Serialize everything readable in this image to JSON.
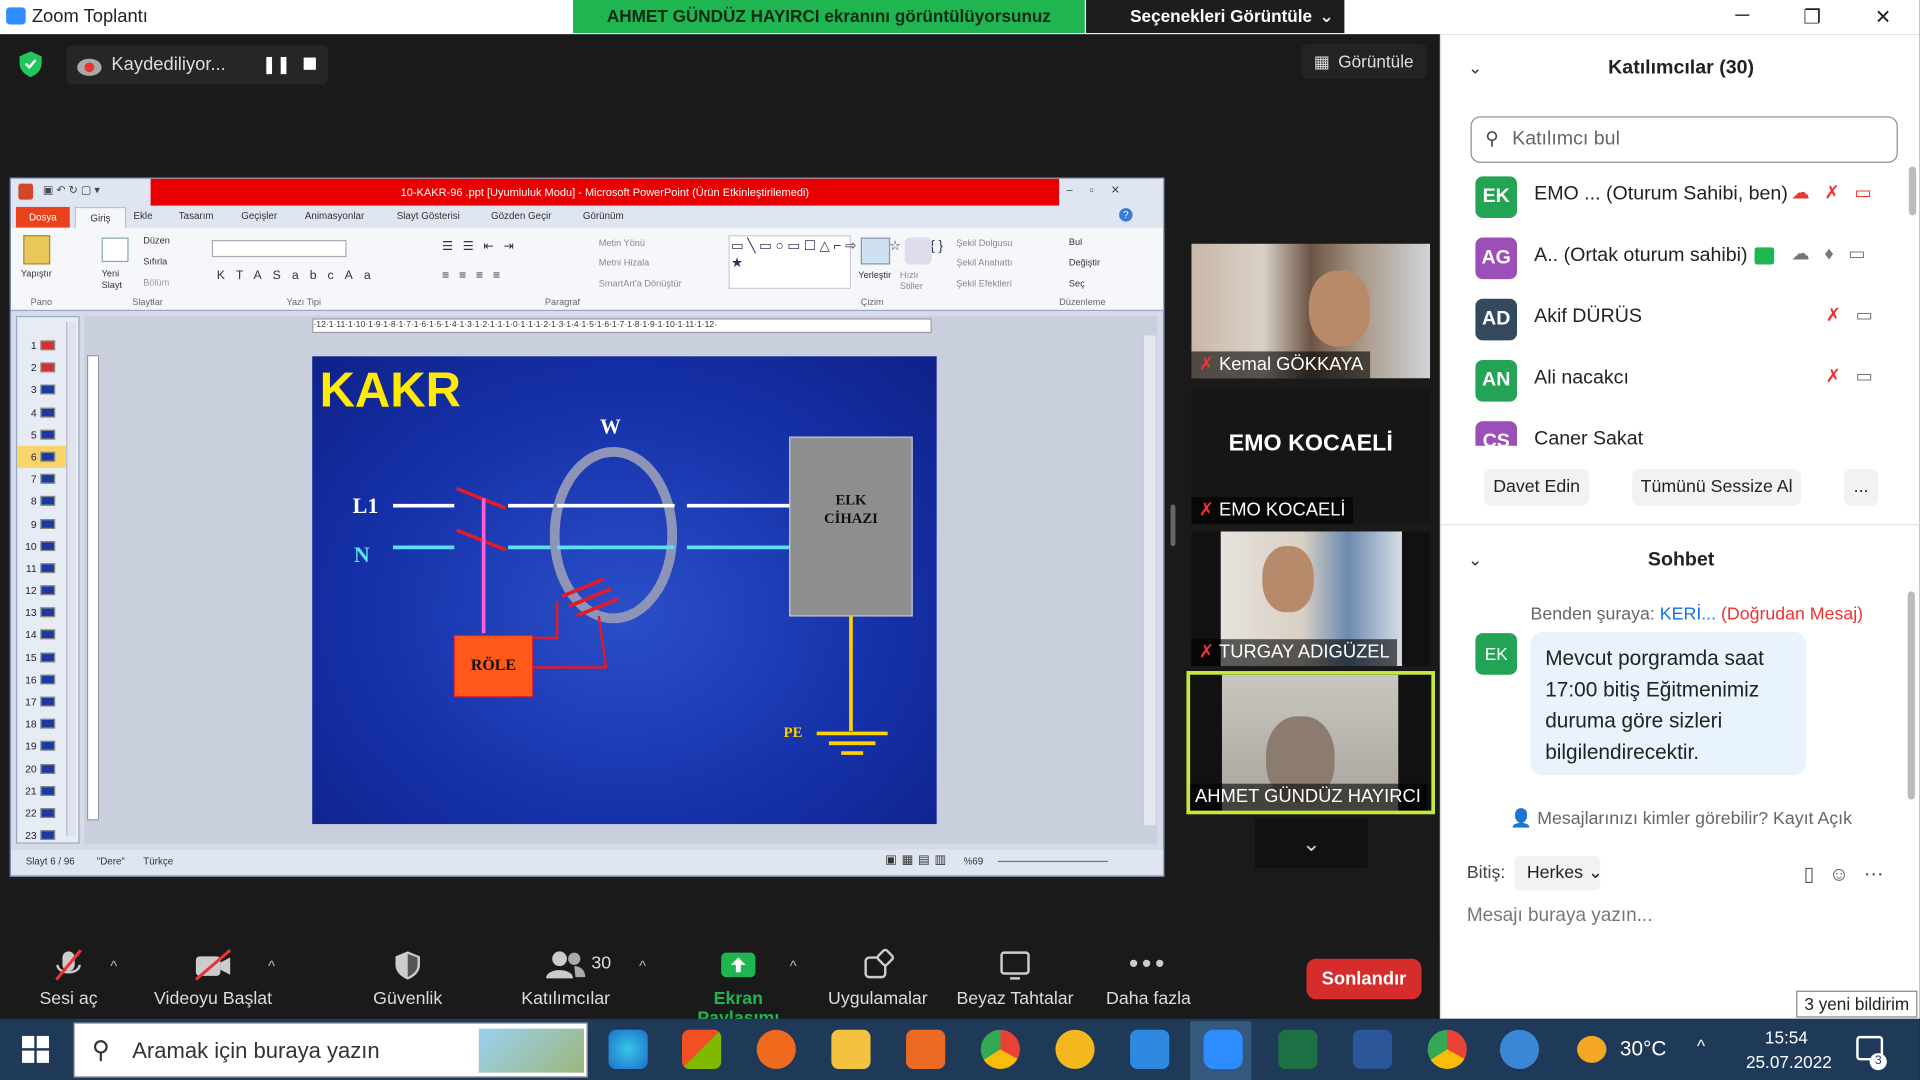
{
  "window": {
    "title": "Zoom Toplantı"
  },
  "banner": {
    "text": "AHMET GÜNDÜZ HAYIRCI ekranını görüntülüyorsunuz",
    "options_label": "Seçenekleri Görüntüle"
  },
  "recording": {
    "label": "Kaydediliyor..."
  },
  "view_button": {
    "label": "Görüntüle"
  },
  "ppt": {
    "title": "10-KAKR-96 .ppt [Uyumluluk Modu] - Microsoft PowerPoint (Ürün Etkinleştirilemedi)",
    "tabs": [
      "Dosya",
      "Giriş",
      "Ekle",
      "Tasarım",
      "Geçişler",
      "Animasyonlar",
      "Slayt Gösterisi",
      "Gözden Geçir",
      "Görünüm"
    ],
    "ribbon": {
      "pano": "Pano",
      "yapistir": "Yapıştır",
      "slaytlar": "Slaytlar",
      "yazi_tipi": "Yazı Tipi",
      "paragraf": "Paragraf",
      "cizim": "Çizim",
      "duzenleme": "Düzenleme",
      "yeni_slayt": "Yeni Slayt",
      "duzen": "Düzen",
      "sifirla": "Sıfırla",
      "bolum": "Bölüm",
      "metin_yonu": "Metin Yönü",
      "metni_hizala": "Metni Hizala",
      "smartart": "SmartArt'a Dönüştür",
      "yerlestir": "Yerleştir",
      "hizli_stiller": "Hızlı Stiller",
      "sekil_dolgusu": "Şekil Dolgusu",
      "sekil_anahatti": "Şekil Anahattı",
      "sekil_efektleri": "Şekil Efektleri",
      "bul": "Bul",
      "degistir": "Değiştir",
      "sec": "Seç"
    },
    "slide_numbers": [
      "1",
      "2",
      "3",
      "4",
      "5",
      "6",
      "7",
      "8",
      "9",
      "10",
      "11",
      "12",
      "13",
      "14",
      "15",
      "16",
      "17",
      "18",
      "19",
      "20",
      "21",
      "22",
      "23"
    ],
    "status": {
      "slide": "Slayt 6 / 96",
      "theme": "\"Dere\"",
      "lang": "Türkçe",
      "zoom": "%69"
    },
    "slide": {
      "heading": "KAKR",
      "w": "W",
      "l1": "L1",
      "n": "N",
      "device": "ELK\nCİHAZI",
      "relay": "RÖLE",
      "pe": "PE"
    }
  },
  "video_tiles": [
    {
      "name": "Kemal GÖKKAYA"
    },
    {
      "name": "EMO KOCAELİ",
      "center_text": "EMO KOCAELİ"
    },
    {
      "name": "TURGAY ADIGÜZEL"
    },
    {
      "name": "AHMET GÜNDÜZ HAYIRCI"
    }
  ],
  "toolbar": {
    "audio": "Sesi aç",
    "video": "Videoyu Başlat",
    "security": "Güvenlik",
    "participants": "Katılımcılar",
    "participants_count": "30",
    "share": "Ekran Paylaşımı",
    "apps": "Uygulamalar",
    "whiteboard": "Beyaz Tahtalar",
    "more": "Daha fazla",
    "end": "Sonlandır"
  },
  "participants_panel": {
    "title": "Katılımcılar (30)",
    "search_placeholder": "Katılımcı bul",
    "list": [
      {
        "initials": "EK",
        "name": "EMO ... (Oturum Sahibi, ben)",
        "color": "#23a455"
      },
      {
        "initials": "AG",
        "name": "A.. (Ortak oturum sahibi)",
        "color": "#9c4fb8"
      },
      {
        "initials": "AD",
        "name": "Akif DÜRÜS",
        "color": "#34495e"
      },
      {
        "initials": "AN",
        "name": "Ali nacakcı",
        "color": "#23a455"
      },
      {
        "initials": "CS",
        "name": "Caner Sakat",
        "color": "#9c4fb8"
      }
    ],
    "invite": "Davet Edin",
    "mute_all": "Tümünü Sessize Al",
    "more": "..."
  },
  "chat": {
    "title": "Sohbet",
    "from": "Benden şuraya:",
    "to": "KERİ...",
    "direct": "(Doğrudan Mesaj)",
    "avatar": "EK",
    "message": "Mevcut porgramda saat 17:00 bitiş Eğitmenimiz duruma göre sizleri bilgilendirecektir.",
    "visibility": "Mesajlarınızı kimler görebilir? Kayıt Açık",
    "to_label": "Bitiş:",
    "recipient": "Herkes",
    "placeholder": "Mesajı buraya yazın..."
  },
  "notification": {
    "text": "3 yeni bildirim"
  },
  "taskbar": {
    "search": "Aramak için buraya yazın",
    "weather": "30°C",
    "time": "15:54",
    "date": "25.07.2022",
    "notif_count": "3"
  }
}
